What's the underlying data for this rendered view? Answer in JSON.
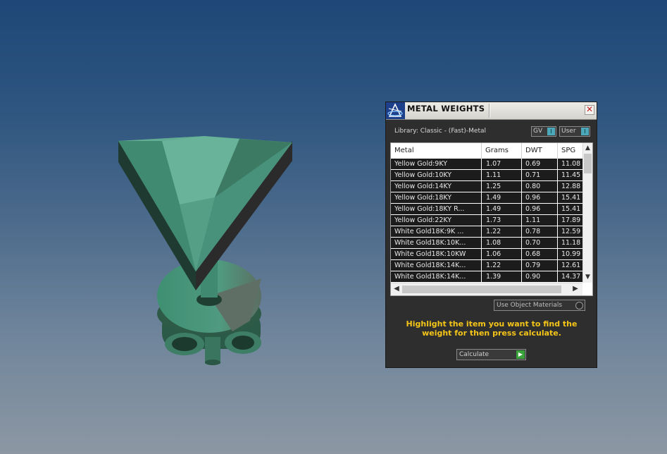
{
  "panel": {
    "title": "METAL WEIGHTS",
    "close_symbol": "✕",
    "library": "Library: Classic - (Fast)-Metal",
    "toggles": [
      {
        "label": "GV",
        "knob": "I"
      },
      {
        "label": "User",
        "knob": "I"
      }
    ],
    "columns": [
      "Metal",
      "Grams",
      "DWT",
      "SPG"
    ],
    "rows": [
      {
        "metal": "Yellow Gold:9KY",
        "grams": "1.07",
        "dwt": "0.69",
        "spg": "11.08"
      },
      {
        "metal": "Yellow Gold:10KY",
        "grams": "1.11",
        "dwt": "0.71",
        "spg": "11.45"
      },
      {
        "metal": "Yellow Gold:14KY",
        "grams": "1.25",
        "dwt": "0.80",
        "spg": "12.88"
      },
      {
        "metal": "Yellow Gold:18KY",
        "grams": "1.49",
        "dwt": "0.96",
        "spg": "15.41"
      },
      {
        "metal": "Yellow Gold:18KY R...",
        "grams": "1.49",
        "dwt": "0.96",
        "spg": "15.41"
      },
      {
        "metal": "Yellow Gold:22KY",
        "grams": "1.73",
        "dwt": "1.11",
        "spg": "17.89"
      },
      {
        "metal": "White Gold18K:9K ...",
        "grams": "1.22",
        "dwt": "0.78",
        "spg": "12.59"
      },
      {
        "metal": "White Gold18K:10K...",
        "grams": "1.08",
        "dwt": "0.70",
        "spg": "11.18"
      },
      {
        "metal": "White Gold18K:10KW",
        "grams": "1.06",
        "dwt": "0.68",
        "spg": "10.99"
      },
      {
        "metal": "White Gold18K:14K...",
        "grams": "1.22",
        "dwt": "0.79",
        "spg": "12.61"
      },
      {
        "metal": "White Gold18K:14K...",
        "grams": "1.39",
        "dwt": "0.90",
        "spg": "14.37"
      }
    ],
    "use_object_materials": "Use Object Materials",
    "hint": "Highlight the item you want to find the weight for then press calculate.",
    "calculate": "Calculate",
    "calculate_icon": "▶"
  },
  "colors": {
    "gem": "#4f9a80",
    "hint": "#f5c518",
    "panel_bg": "#2e2e2e"
  },
  "icons": {
    "logo": "app-logo-icon",
    "close": "close-icon",
    "scroll_up": "▲",
    "scroll_down": "▼",
    "scroll_left": "◀",
    "scroll_right": "▶"
  }
}
